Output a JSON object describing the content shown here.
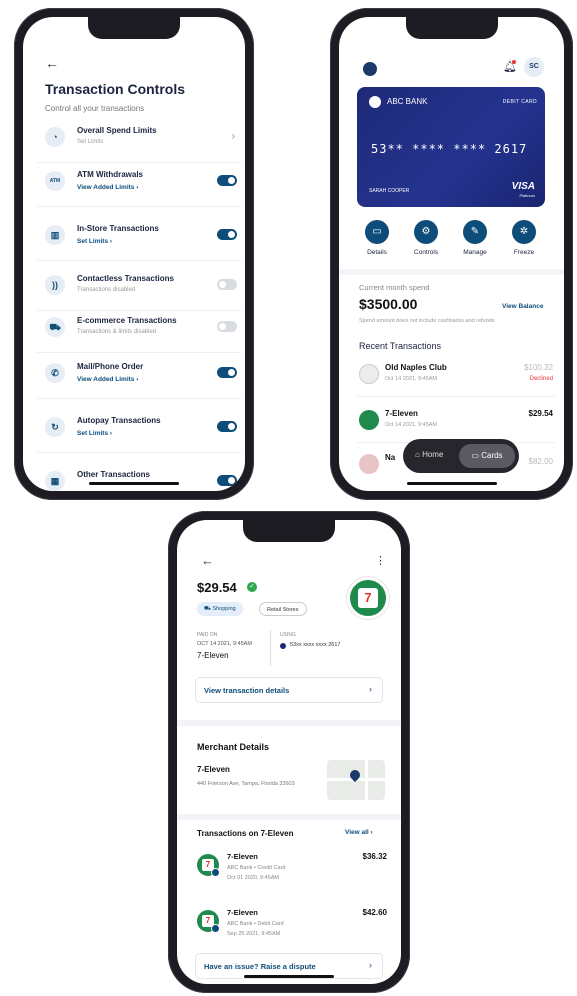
{
  "controls_screen": {
    "back_icon": "arrow-left-icon",
    "title": "Transaction Controls",
    "subtitle": "Control all your transactions",
    "items": [
      {
        "name": "Overall Spend Limits",
        "sub": "Set Limits",
        "link": "",
        "toggle": "chevron",
        "icon": "gauge-icon",
        "glyph": "◔"
      },
      {
        "name": "ATM Withdrawals",
        "sub": "",
        "link": "View Added Limits ›",
        "toggle": "on",
        "icon": "atm-icon",
        "glyph": "ATM"
      },
      {
        "name": "In-Store Transactions",
        "sub": "",
        "link": "Set Limits ›",
        "toggle": "on",
        "icon": "store-icon",
        "glyph": "▥"
      },
      {
        "name": "Contactless Transactions",
        "sub": "Transactions disabled",
        "link": "",
        "toggle": "off",
        "icon": "contactless-icon",
        "glyph": "))"
      },
      {
        "name": "E-commerce Transactions",
        "sub": "Transactions & limits disabled",
        "link": "",
        "toggle": "off",
        "icon": "cart-icon",
        "glyph": "⛟"
      },
      {
        "name": "Mail/Phone Order",
        "sub": "",
        "link": "View Added Limits ›",
        "toggle": "on",
        "icon": "phone-icon",
        "glyph": "✆"
      },
      {
        "name": "Autopay Transactions",
        "sub": "",
        "link": "Set Limits ›",
        "toggle": "on",
        "icon": "autopay-icon",
        "glyph": "↻"
      },
      {
        "name": "Other Transactions",
        "sub": "",
        "link": "",
        "toggle": "on",
        "icon": "grid-icon",
        "glyph": "▦"
      }
    ]
  },
  "cards_screen": {
    "avatar": "SC",
    "card": {
      "bank": "ABC BANK",
      "type": "DEBIT CARD",
      "number": "53** **** **** 2617",
      "holder": "SARAH COOPER",
      "network": "VISA",
      "tier": "Platinum"
    },
    "actions": [
      {
        "label": "Details",
        "icon": "card-icon",
        "glyph": "▭"
      },
      {
        "label": "Controls",
        "icon": "gear-icon",
        "glyph": "⚙"
      },
      {
        "label": "Manage",
        "icon": "wrench-icon",
        "glyph": "✎"
      },
      {
        "label": "Freeze",
        "icon": "snowflake-icon",
        "glyph": "✲"
      }
    ],
    "spend_label": "Current month spend",
    "spend_amount": "$3500.00",
    "view_balance": "View Balance",
    "spend_note": "Spend amount does not include cashbacks and refunds",
    "recent_title": "Recent Transactions",
    "transactions": [
      {
        "merchant": "Old Naples Club",
        "date": "Oct 14 2021, 9:45AM",
        "amount": "$100.32",
        "status": "Declined"
      },
      {
        "merchant": "7-Eleven",
        "date": "Oct 14 2021, 9:45AM",
        "amount": "$29.54",
        "status": ""
      },
      {
        "merchant": "Na",
        "date": "",
        "amount": "$82.00",
        "status": ""
      }
    ],
    "nav": {
      "home": "Home",
      "cards": "Cards"
    }
  },
  "detail_screen": {
    "amount": "$29.54",
    "tags": [
      "Shopping",
      "Retail Stores"
    ],
    "paid_on_label": "PAID ON",
    "paid_on_date": "OCT 14 2021, 9:45AM",
    "paid_to": "7-Eleven",
    "using_label": "USING",
    "using_value": "53xx xxxx xxxx 2617",
    "view_details": "View transaction details",
    "merchant_title": "Merchant Details",
    "merchant_name": "7-Eleven",
    "merchant_address": "440 Frierson Ave, Tampa, Florida 33603",
    "tx_title": "Transactions on 7-Eleven",
    "view_all": "View all ›",
    "merchant_tx": [
      {
        "merchant": "7-Eleven",
        "source": "ABC Bank • Credit Card",
        "date": "Oct 01 2020, 9:45AM",
        "amount": "$36.32"
      },
      {
        "merchant": "7-Eleven",
        "source": "ABC Bank • Debit Card",
        "date": "Sep 25 2021, 9:45AM",
        "amount": "$42.60"
      }
    ],
    "dispute": "Have an issue? Raise a dispute"
  },
  "colors": {
    "primary": "#0e4d7a",
    "card": "#1e2a78",
    "success": "#2fa84f",
    "danger": "#e53935"
  }
}
